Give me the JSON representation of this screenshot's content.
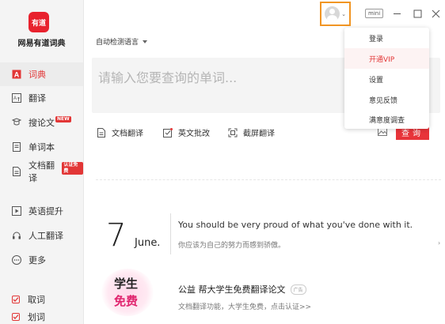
{
  "app": {
    "logo_text": "有道",
    "name": "网易有道词典"
  },
  "sidebar": {
    "items": [
      {
        "label": "词典",
        "icon": "dictionary-icon",
        "active": true
      },
      {
        "label": "翻译",
        "icon": "translate-icon"
      },
      {
        "label": "搜论文",
        "icon": "paper-search-icon",
        "badge": "NEW"
      },
      {
        "label": "单词本",
        "icon": "wordbook-icon"
      },
      {
        "label": "文档翻译",
        "icon": "document-icon",
        "badge": "认证免费"
      },
      {
        "label": "英语提升",
        "icon": "play-icon"
      },
      {
        "label": "人工翻译",
        "icon": "headset-icon"
      },
      {
        "label": "更多",
        "icon": "more-icon"
      }
    ],
    "checks": [
      {
        "label": "取词",
        "checked": true
      },
      {
        "label": "划词",
        "checked": true
      }
    ]
  },
  "toolbar": {
    "lang_select": "自动检测语言",
    "mini_label": "mini"
  },
  "search": {
    "placeholder": "请输入您要查询的单词...",
    "query_button": "查询"
  },
  "tools": [
    {
      "label": "文档翻译",
      "icon": "document-translate-icon"
    },
    {
      "label": "英文批改",
      "icon": "english-correction-icon"
    },
    {
      "label": "截屏翻译",
      "icon": "screenshot-translate-icon"
    }
  ],
  "daily": {
    "day": "7",
    "month": "June.",
    "en": "You should be very proud of what you've done with it.",
    "zh": "你应该为自己的努力而感到骄傲。"
  },
  "ad": {
    "image_line1": "学生",
    "image_line2": "免费",
    "title": "公益  帮大学生免费翻译论文",
    "tag": "广告",
    "desc": "文档翻译功能，大学生免费，点击认证>>"
  },
  "user_menu": {
    "items": [
      "登录",
      "开通VIP",
      "设置",
      "意见反馈",
      "满意度调查"
    ]
  },
  "colors": {
    "accent": "#e23636",
    "highlight_border": "#f19523"
  }
}
